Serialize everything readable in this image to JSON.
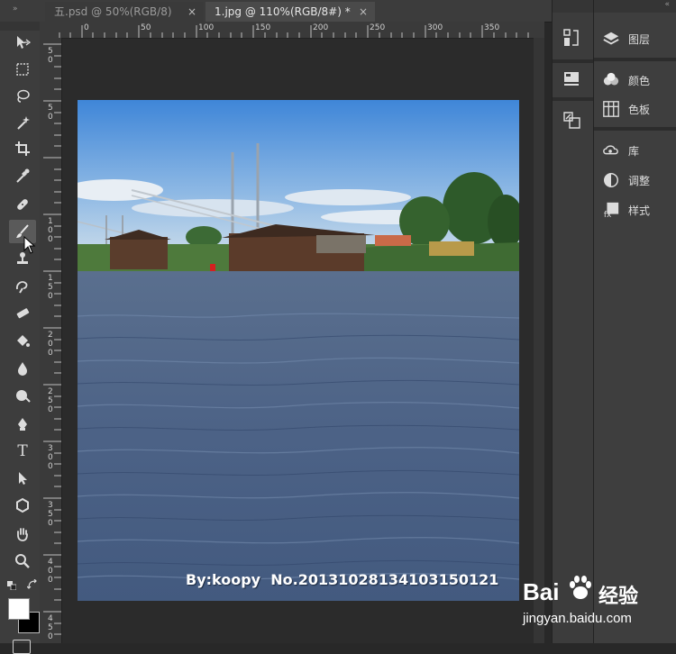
{
  "tabs": [
    {
      "label": "五.psd @ 50%(RGB/8)",
      "close": "×",
      "active": false
    },
    {
      "label": "1.jpg @ 110%(RGB/8#) *",
      "close": "×",
      "active": true
    }
  ],
  "ruler": {
    "top_labels": [
      "0",
      "50",
      "100",
      "150",
      "200",
      "250",
      "300",
      "350"
    ],
    "left_labels": [
      "5\n0",
      "5\n0",
      "1\n0\n0",
      "1\n5\n0",
      "2\n0\n0",
      "2\n5\n0",
      "3\n0\n0",
      "3\n5\n0",
      "4\n0\n0",
      "4\n5\n0"
    ]
  },
  "toolbar": {
    "tools": [
      "move-tool",
      "marquee-tool",
      "lasso-tool",
      "magic-wand-tool",
      "crop-tool",
      "eyedropper-tool",
      "healing-brush-tool",
      "brush-tool",
      "clone-stamp-tool",
      "history-brush-tool",
      "eraser-tool",
      "paint-bucket-tool",
      "blur-tool",
      "dodge-tool",
      "pen-tool",
      "type-tool",
      "path-selection-tool",
      "shape-tool",
      "hand-tool",
      "zoom-tool"
    ],
    "type_glyph": "T"
  },
  "photo": {
    "caption": "By:koopy  No.20131028134103150121"
  },
  "panels": {
    "items": [
      {
        "icon": "layers-icon",
        "label": "图层"
      },
      {
        "icon": "color-icon",
        "label": "颜色"
      },
      {
        "icon": "swatches-icon",
        "label": "色板"
      },
      {
        "icon": "library-icon",
        "label": "库"
      },
      {
        "icon": "adjustments-icon",
        "label": "调整"
      },
      {
        "icon": "styles-icon",
        "label": "样式"
      }
    ]
  },
  "watermark": {
    "brand": "Bai",
    "brand2": "经验",
    "url": "jingyan.baidu.com"
  },
  "colors": {
    "app_bg": "#282828",
    "panel": "#3e3e3e",
    "sky": "#4a8fd6",
    "water": "#4d6487"
  }
}
